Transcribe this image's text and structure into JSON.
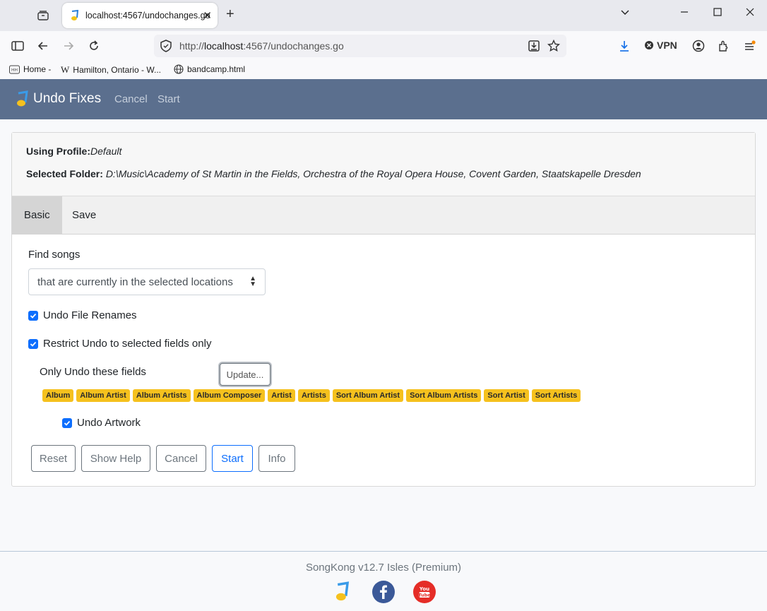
{
  "browser": {
    "tab_title": "localhost:4567/undochanges.go",
    "tab_close": "✕",
    "new_tab": "+",
    "url_prefix": "http://",
    "url_host": "localhost",
    "url_rest": ":4567/undochanges.go",
    "vpn_label": "VPN",
    "bookmarks": [
      "Home -",
      "Hamilton, Ontario - W...",
      "bandcamp.html"
    ]
  },
  "app_nav": {
    "brand": "Undo Fixes",
    "links": [
      "Cancel",
      "Start"
    ]
  },
  "card": {
    "profile_label": "Using Profile:",
    "profile_value": "Default",
    "folder_label": "Selected Folder:",
    "folder_value": "D:\\Music\\Academy of St Martin in the Fields, Orchestra of the Royal Opera House, Covent Garden, Staatskapelle Dresden",
    "tabs": [
      "Basic",
      "Save"
    ],
    "active_tab": "Basic"
  },
  "form": {
    "find_songs_label": "Find songs",
    "find_songs_value": "that are currently in the selected locations",
    "undo_renames_label": "Undo File Renames",
    "undo_renames_checked": true,
    "restrict_label": "Restrict Undo to selected fields only",
    "restrict_checked": true,
    "only_fields_label": "Only Undo these fields",
    "update_button": "Update...",
    "fields": [
      "Album",
      "Album Artist",
      "Album Artists",
      "Album Composer",
      "Artist",
      "Artists",
      "Sort Album Artist",
      "Sort Album Artists",
      "Sort Artist",
      "Sort Artists"
    ],
    "undo_artwork_label": "Undo Artwork",
    "undo_artwork_checked": true
  },
  "buttons": {
    "reset": "Reset",
    "show_help": "Show Help",
    "cancel": "Cancel",
    "start": "Start",
    "info": "Info"
  },
  "footer": {
    "version_text": "SongKong v12.7 Isles (Premium)"
  },
  "colors": {
    "app_nav_bg": "#5b6f8e",
    "badge": "#f5c11e",
    "primary": "#0d6efd",
    "facebook": "#3b5998",
    "youtube": "#e52d27"
  }
}
